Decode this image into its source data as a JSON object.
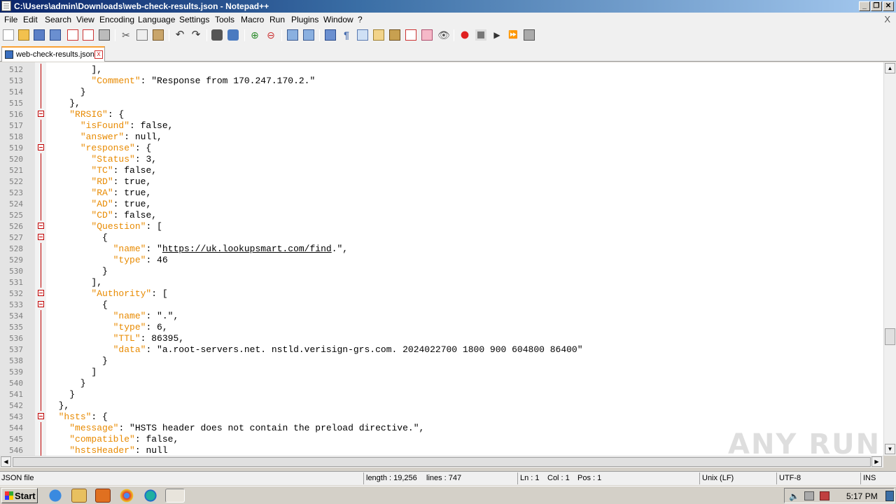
{
  "window": {
    "title": "C:\\Users\\admin\\Downloads\\web-check-results.json - Notepad++"
  },
  "menu": [
    "File",
    "Edit",
    "Search",
    "View",
    "Encoding",
    "Language",
    "Settings",
    "Tools",
    "Macro",
    "Run",
    "Plugins",
    "Window",
    "?"
  ],
  "menu_close": "X",
  "tab": {
    "label": "web-check-results.json",
    "close": "x"
  },
  "status": {
    "filetype": "JSON file",
    "length": "length : 19,256",
    "lines": "lines : 747",
    "ln": "Ln : 1",
    "col": "Col : 1",
    "pos": "Pos : 1",
    "eol": "Unix (LF)",
    "encoding": "UTF-8",
    "mode": "INS"
  },
  "taskbar": {
    "start": "Start",
    "clock": "5:17 PM"
  },
  "watermark": "ANY RUN",
  "code_lines": [
    {
      "n": "512",
      "fold": "line",
      "parts": [
        [
          "t",
          "        ],"
        ]
      ]
    },
    {
      "n": "513",
      "fold": "line",
      "parts": [
        [
          "t",
          "        "
        ],
        [
          "k",
          "\"Comment\""
        ],
        [
          "t",
          ": \"Response from 170.247.170.2.\""
        ]
      ]
    },
    {
      "n": "514",
      "fold": "line",
      "parts": [
        [
          "t",
          "      }"
        ]
      ]
    },
    {
      "n": "515",
      "fold": "line",
      "parts": [
        [
          "t",
          "    },"
        ]
      ]
    },
    {
      "n": "516",
      "fold": "box",
      "parts": [
        [
          "t",
          "    "
        ],
        [
          "k",
          "\"RRSIG\""
        ],
        [
          "t",
          ": {"
        ]
      ]
    },
    {
      "n": "517",
      "fold": "line",
      "parts": [
        [
          "t",
          "      "
        ],
        [
          "k",
          "\"isFound\""
        ],
        [
          "t",
          ": false,"
        ]
      ]
    },
    {
      "n": "518",
      "fold": "line",
      "parts": [
        [
          "t",
          "      "
        ],
        [
          "k",
          "\"answer\""
        ],
        [
          "t",
          ": null,"
        ]
      ]
    },
    {
      "n": "519",
      "fold": "box",
      "parts": [
        [
          "t",
          "      "
        ],
        [
          "k",
          "\"response\""
        ],
        [
          "t",
          ": {"
        ]
      ]
    },
    {
      "n": "520",
      "fold": "line",
      "parts": [
        [
          "t",
          "        "
        ],
        [
          "k",
          "\"Status\""
        ],
        [
          "t",
          ": 3,"
        ]
      ]
    },
    {
      "n": "521",
      "fold": "line",
      "parts": [
        [
          "t",
          "        "
        ],
        [
          "k",
          "\"TC\""
        ],
        [
          "t",
          ": false,"
        ]
      ]
    },
    {
      "n": "522",
      "fold": "line",
      "parts": [
        [
          "t",
          "        "
        ],
        [
          "k",
          "\"RD\""
        ],
        [
          "t",
          ": true,"
        ]
      ]
    },
    {
      "n": "523",
      "fold": "line",
      "parts": [
        [
          "t",
          "        "
        ],
        [
          "k",
          "\"RA\""
        ],
        [
          "t",
          ": true,"
        ]
      ]
    },
    {
      "n": "524",
      "fold": "line",
      "parts": [
        [
          "t",
          "        "
        ],
        [
          "k",
          "\"AD\""
        ],
        [
          "t",
          ": true,"
        ]
      ]
    },
    {
      "n": "525",
      "fold": "line",
      "parts": [
        [
          "t",
          "        "
        ],
        [
          "k",
          "\"CD\""
        ],
        [
          "t",
          ": false,"
        ]
      ]
    },
    {
      "n": "526",
      "fold": "box",
      "parts": [
        [
          "t",
          "        "
        ],
        [
          "k",
          "\"Question\""
        ],
        [
          "t",
          ": ["
        ]
      ]
    },
    {
      "n": "527",
      "fold": "box",
      "parts": [
        [
          "t",
          "          {"
        ]
      ]
    },
    {
      "n": "528",
      "fold": "line",
      "parts": [
        [
          "t",
          "            "
        ],
        [
          "k",
          "\"name\""
        ],
        [
          "t",
          ": \""
        ],
        [
          "u",
          "https://uk.lookupsmart.com/find"
        ],
        [
          "t",
          ".\","
        ]
      ]
    },
    {
      "n": "529",
      "fold": "line",
      "parts": [
        [
          "t",
          "            "
        ],
        [
          "k",
          "\"type\""
        ],
        [
          "t",
          ": 46"
        ]
      ]
    },
    {
      "n": "530",
      "fold": "line",
      "parts": [
        [
          "t",
          "          }"
        ]
      ]
    },
    {
      "n": "531",
      "fold": "line",
      "parts": [
        [
          "t",
          "        ],"
        ]
      ]
    },
    {
      "n": "532",
      "fold": "box",
      "parts": [
        [
          "t",
          "        "
        ],
        [
          "k",
          "\"Authority\""
        ],
        [
          "t",
          ": ["
        ]
      ]
    },
    {
      "n": "533",
      "fold": "box",
      "parts": [
        [
          "t",
          "          {"
        ]
      ]
    },
    {
      "n": "534",
      "fold": "line",
      "parts": [
        [
          "t",
          "            "
        ],
        [
          "k",
          "\"name\""
        ],
        [
          "t",
          ": \".\","
        ]
      ]
    },
    {
      "n": "535",
      "fold": "line",
      "parts": [
        [
          "t",
          "            "
        ],
        [
          "k",
          "\"type\""
        ],
        [
          "t",
          ": 6,"
        ]
      ]
    },
    {
      "n": "536",
      "fold": "line",
      "parts": [
        [
          "t",
          "            "
        ],
        [
          "k",
          "\"TTL\""
        ],
        [
          "t",
          ": 86395,"
        ]
      ]
    },
    {
      "n": "537",
      "fold": "line",
      "parts": [
        [
          "t",
          "            "
        ],
        [
          "k",
          "\"data\""
        ],
        [
          "t",
          ": \"a.root-servers.net. nstld.verisign-grs.com. 2024022700 1800 900 604800 86400\""
        ]
      ]
    },
    {
      "n": "538",
      "fold": "line",
      "parts": [
        [
          "t",
          "          }"
        ]
      ]
    },
    {
      "n": "539",
      "fold": "line",
      "parts": [
        [
          "t",
          "        ]"
        ]
      ]
    },
    {
      "n": "540",
      "fold": "line",
      "parts": [
        [
          "t",
          "      }"
        ]
      ]
    },
    {
      "n": "541",
      "fold": "line",
      "parts": [
        [
          "t",
          "    }"
        ]
      ]
    },
    {
      "n": "542",
      "fold": "line",
      "parts": [
        [
          "t",
          "  },"
        ]
      ]
    },
    {
      "n": "543",
      "fold": "box",
      "parts": [
        [
          "t",
          "  "
        ],
        [
          "k",
          "\"hsts\""
        ],
        [
          "t",
          ": {"
        ]
      ]
    },
    {
      "n": "544",
      "fold": "line",
      "parts": [
        [
          "t",
          "    "
        ],
        [
          "k",
          "\"message\""
        ],
        [
          "t",
          ": \"HSTS header does not contain the preload directive.\","
        ]
      ]
    },
    {
      "n": "545",
      "fold": "line",
      "parts": [
        [
          "t",
          "    "
        ],
        [
          "k",
          "\"compatible\""
        ],
        [
          "t",
          ": false,"
        ]
      ]
    },
    {
      "n": "546",
      "fold": "line",
      "parts": [
        [
          "t",
          "    "
        ],
        [
          "k",
          "\"hstsHeader\""
        ],
        [
          "t",
          ": null"
        ]
      ]
    }
  ]
}
